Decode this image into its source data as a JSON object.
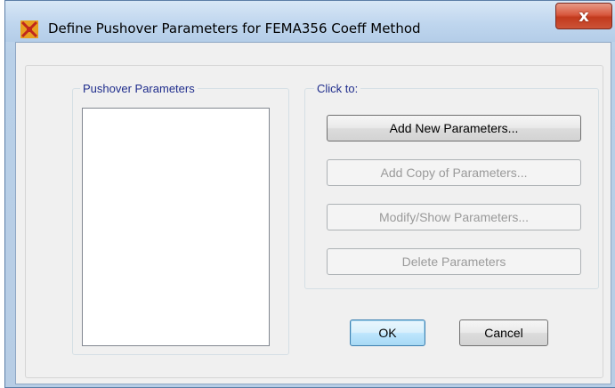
{
  "window": {
    "title": "Define Pushover Parameters for FEMA356 Coeff Method",
    "close_label": "x"
  },
  "pushover_group": {
    "legend": "Pushover Parameters",
    "items": []
  },
  "click_group": {
    "legend": "Click to:",
    "buttons": {
      "add_new": "Add New Parameters...",
      "add_copy": "Add Copy of Parameters...",
      "modify_show": "Modify/Show Parameters...",
      "delete": "Delete Parameters"
    }
  },
  "footer": {
    "ok_label": "OK",
    "cancel_label": "Cancel"
  },
  "colors": {
    "title_bar": "#bfd6ee",
    "close_button": "#c23a1d",
    "legend_text": "#1f2d8c",
    "disabled_text": "#9a9a9a"
  }
}
